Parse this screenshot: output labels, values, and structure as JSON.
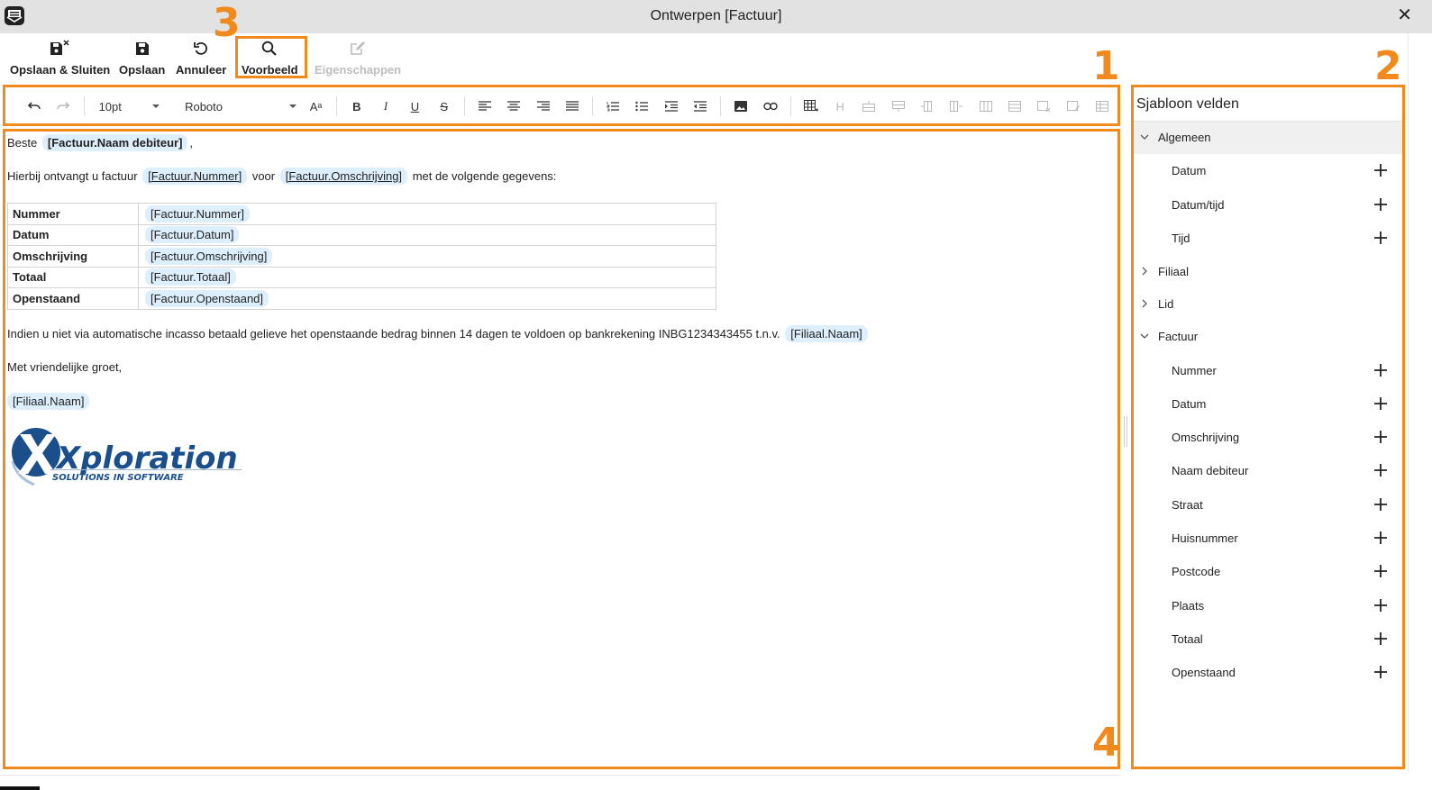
{
  "window": {
    "title": "Ontwerpen [Factuur]",
    "close_glyph": "✕"
  },
  "toolbar": {
    "save_close": "Opslaan & Sluiten",
    "save": "Opslaan",
    "cancel": "Annuleer",
    "preview": "Voorbeeld",
    "properties": "Eigenschappen"
  },
  "annotations": {
    "n1": "1",
    "n2": "2",
    "n3": "3",
    "n4": "4"
  },
  "format_bar": {
    "font_size": "10pt",
    "font_family": "Roboto",
    "bold_glyph": "B",
    "italic_glyph": "I",
    "underline_glyph": "U",
    "strike_glyph": "S",
    "heading_glyph": "H",
    "fontsize_glyph": "Aᵃ"
  },
  "editor": {
    "greeting": "Beste",
    "greeting_field": "[Factuur.Naam debiteur]",
    "greeting_comma": ",",
    "line2_prefix": "Hierbij ontvangt u factuur",
    "line2_field1": "[Factuur.Nummer]",
    "line2_mid": "voor",
    "line2_field2": "[Factuur.Omschrijving]",
    "line2_suffix": "met de volgende gegevens:",
    "table": [
      {
        "label": "Nummer",
        "value": "[Factuur.Nummer]"
      },
      {
        "label": "Datum",
        "value": "[Factuur.Datum]"
      },
      {
        "label": "Omschrijving",
        "value": "[Factuur.Omschrijving]"
      },
      {
        "label": "Totaal",
        "value": "[Factuur.Totaal]"
      },
      {
        "label": "Openstaand",
        "value": "[Factuur.Openstaand]"
      }
    ],
    "para3": "Indien u niet via automatische incasso betaald gelieve het openstaande bedrag binnen 14 dagen te voldoen op bankrekening INBG1234343455 t.n.v.",
    "para3_field": "[Filiaal.Naam]",
    "closing": "Met vriendelijke groet,",
    "signature_field": "[Filiaal.Naam]",
    "logo": {
      "brand": "Xploration",
      "tagline": "SOLUTIONS IN SOFTWARE",
      "color": "#1b4f8c"
    }
  },
  "panel": {
    "title": "Sjabloon velden",
    "groups": [
      {
        "label": "Algemeen",
        "expanded": true,
        "items": [
          "Datum",
          "Datum/tijd",
          "Tijd"
        ]
      },
      {
        "label": "Filiaal",
        "expanded": false,
        "items": []
      },
      {
        "label": "Lid",
        "expanded": false,
        "items": []
      },
      {
        "label": "Factuur",
        "expanded": true,
        "items": [
          "Nummer",
          "Datum",
          "Omschrijving",
          "Naam debiteur",
          "Straat",
          "Huisnummer",
          "Postcode",
          "Plaats",
          "Totaal",
          "Openstaand"
        ]
      }
    ]
  },
  "colors": {
    "annotation": "#f18a1c",
    "chip": "#ddeffc",
    "titlebar": "#e2e2e2"
  }
}
